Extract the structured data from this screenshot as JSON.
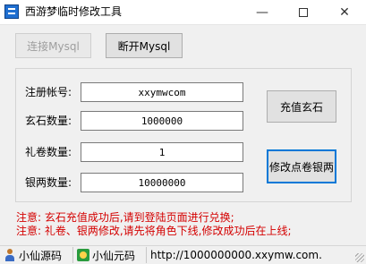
{
  "window": {
    "title": "西游梦临时修改工具"
  },
  "toolbar": {
    "connect_label": "连接Mysql",
    "disconnect_label": "断开Mysql"
  },
  "form": {
    "account": {
      "label": "注册帐号:",
      "value": "xxymwcom"
    },
    "xuanshi": {
      "label": "玄石数量:",
      "value": "1000000"
    },
    "lijuan": {
      "label": "礼卷数量:",
      "value": "1"
    },
    "yinliang": {
      "label": "银两数量:",
      "value": "10000000"
    }
  },
  "actions": {
    "recharge_label": "充值玄石",
    "modify_label": "修改点卷银两"
  },
  "notes": {
    "line1": "注意: 玄石充值成功后,请到登陆页面进行兑换;",
    "line2": "注意: 礼卷、银两修改,请先将角色下线,修改成功后在上线;"
  },
  "statusbar": {
    "panel1": "小仙源码",
    "panel2": "小仙元码",
    "panel3": "http://1000000000.xxymw.com."
  },
  "colors": {
    "note": "#d40000",
    "focus": "#0078d7"
  }
}
